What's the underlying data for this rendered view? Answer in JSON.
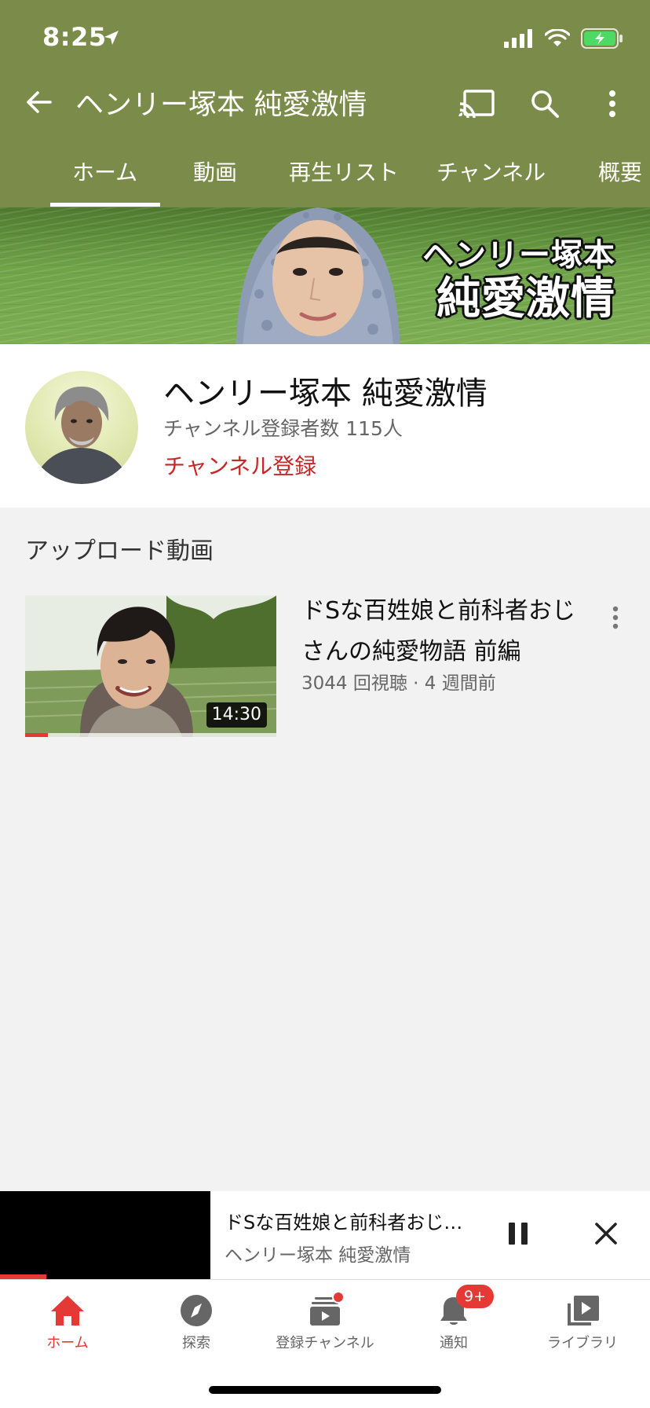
{
  "colors": {
    "header_bg": "#7b8b49",
    "accent_red": "#e53935",
    "subscribe_red": "#c62828",
    "page_bg": "#f2f2f2"
  },
  "status_bar": {
    "time": "8:25",
    "location_icon": "location-arrow-icon",
    "signal_icon": "cellular-signal-icon",
    "wifi_icon": "wifi-icon",
    "battery_icon": "battery-charging-icon"
  },
  "app_bar": {
    "title": "ヘンリー塚本 純愛激情",
    "back_icon": "back-arrow-icon",
    "cast_icon": "cast-icon",
    "search_icon": "search-icon",
    "more_icon": "more-vert-icon"
  },
  "tabs": [
    {
      "label": "ホーム",
      "active": true
    },
    {
      "label": "動画",
      "active": false
    },
    {
      "label": "再生リスト",
      "active": false
    },
    {
      "label": "チャンネル",
      "active": false
    },
    {
      "label": "概要",
      "active": false
    }
  ],
  "banner": {
    "line1": "ヘンリー塚本",
    "line2": "純愛激情"
  },
  "channel": {
    "name": "ヘンリー塚本 純愛激情",
    "subscribers": "チャンネル登録者数 115人",
    "subscribe_label": "チャンネル登録"
  },
  "uploads": {
    "section_title": "アップロード動画",
    "videos": [
      {
        "title": "ドSな百姓娘と前科者おじさんの純愛物語 前編",
        "stats": "3044 回視聴 · 4 週間前",
        "duration": "14:30",
        "watched_fraction": 0.09
      }
    ]
  },
  "miniplayer": {
    "title": "ドSな百姓娘と前科者おじ…",
    "channel": "ヘンリー塚本 純愛激情",
    "progress_fraction": 0.22,
    "pause_icon": "pause-icon",
    "close_icon": "close-icon"
  },
  "bottom_nav": [
    {
      "label": "ホーム",
      "icon": "home-icon",
      "active": true
    },
    {
      "label": "探索",
      "icon": "explore-icon",
      "active": false
    },
    {
      "label": "登録チャンネル",
      "icon": "subscriptions-icon",
      "active": false,
      "dot": true
    },
    {
      "label": "通知",
      "icon": "notifications-icon",
      "active": false,
      "badge": "9+"
    },
    {
      "label": "ライブラリ",
      "icon": "library-icon",
      "active": false
    }
  ]
}
